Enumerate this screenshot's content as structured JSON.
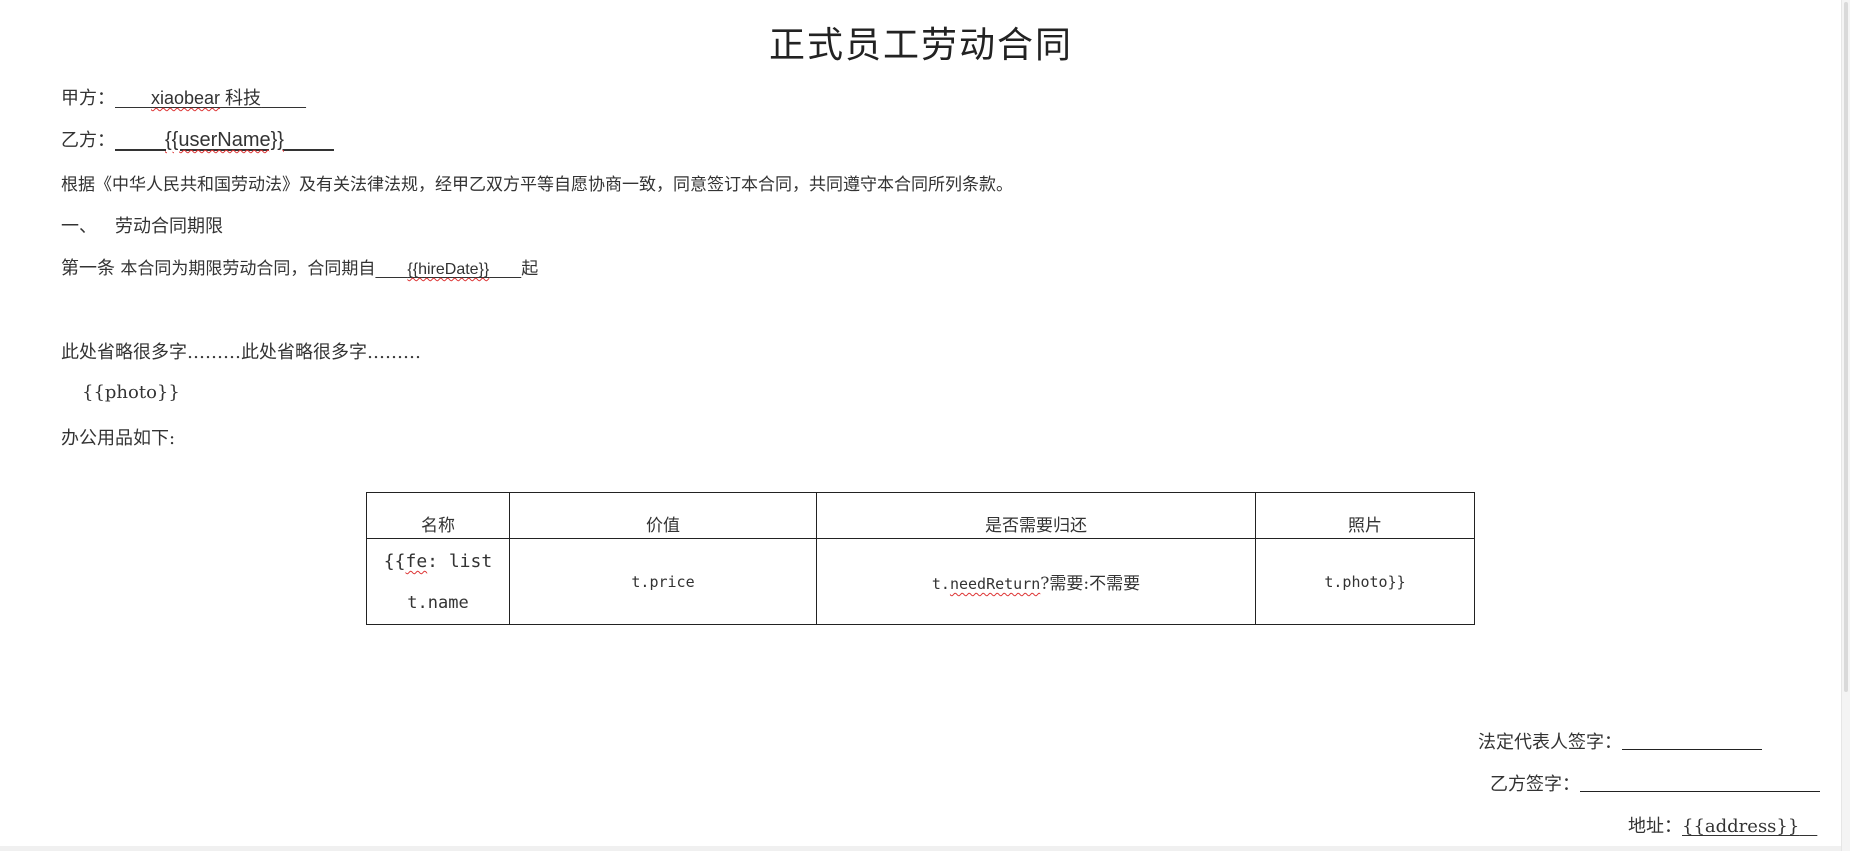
{
  "document": {
    "title": "正式员工劳动合同",
    "party_a": {
      "label": "甲方：",
      "value_latin": "xiaobear",
      "value_cn": " 科技"
    },
    "party_b": {
      "label": "乙方：",
      "value": "{{userName}}"
    },
    "preamble": "根据《中华人民共和国劳动法》及有关法律法规，经甲乙双方平等自愿协商一致，同意签订本合同，共同遵守本合同所列条款。",
    "section1": {
      "number": "一、",
      "heading": "劳动合同期限"
    },
    "article1": {
      "label": "第一条",
      "text": " 本合同为期限劳动合同，合同期自",
      "date_var": "{{hireDate}}",
      "suffix": "起"
    },
    "omitted": "此处省略很多字………此处省略很多字………",
    "photo_var": "{{photo}}",
    "supplies_intro": "办公用品如下:"
  },
  "table": {
    "headers": [
      "名称",
      "价值",
      "是否需要归还",
      "照片"
    ],
    "row": {
      "name_line1_prefix": "{{",
      "name_line1_fe": "fe",
      "name_line1_rest": ": list",
      "name_line2": "t.name",
      "price": "t.price",
      "return_prefix": "t.",
      "return_var": "needReturn",
      "return_rest": "?需要:不需要",
      "photo": "t.photo}}"
    }
  },
  "signatures": {
    "legal_rep_label": "法定代表人签字：",
    "party_b_label": "乙方签字：",
    "address_label": "地址：",
    "address_var": "{{address}}"
  }
}
